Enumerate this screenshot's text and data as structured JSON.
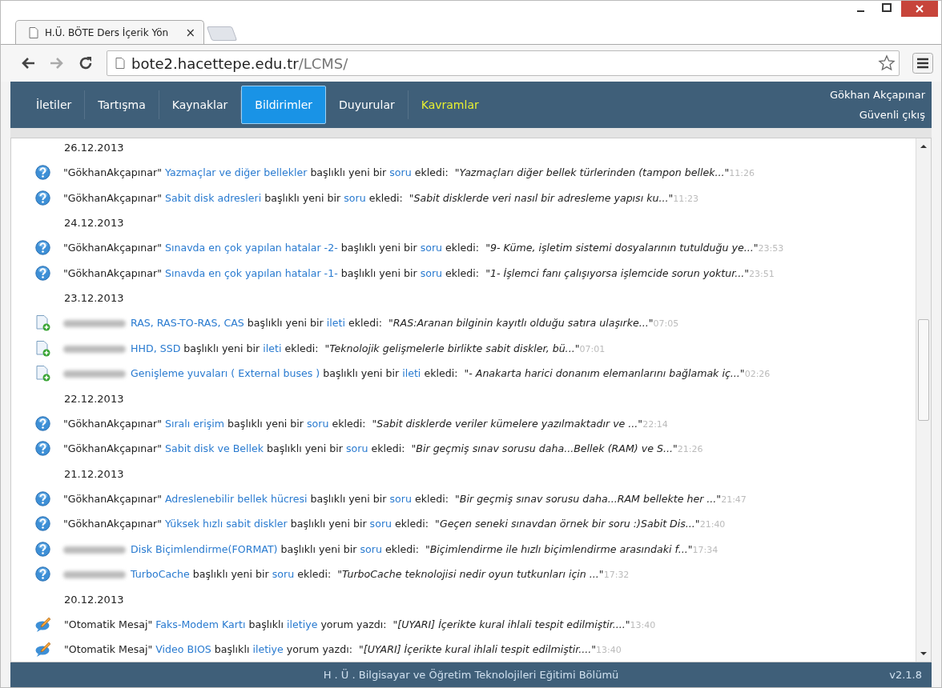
{
  "browser": {
    "tab_title": "H.Ü. BÖTE Ders İçerik Yön",
    "tab_close": "×",
    "url": {
      "host": "bote2.hacettepe.edu.tr",
      "path": "/LCMS/"
    }
  },
  "nav": {
    "items": [
      {
        "label": "İletiler",
        "selected": false,
        "highlight": false
      },
      {
        "label": "Tartışma",
        "selected": false,
        "highlight": false
      },
      {
        "label": "Kaynaklar",
        "selected": false,
        "highlight": false
      },
      {
        "label": "Bildirimler",
        "selected": true,
        "highlight": false
      },
      {
        "label": "Duyurular",
        "selected": false,
        "highlight": false
      },
      {
        "label": "Kavramlar",
        "selected": false,
        "highlight": true
      }
    ],
    "user": "Gökhan Akçapınar",
    "logout": "Güvenli çıkış"
  },
  "groups": [
    {
      "date": "26.12.2013",
      "items": [
        {
          "kind": "question",
          "author": "\"GökhanAkçapınar\"",
          "title": "Yazmaçlar ve diğer bellekler",
          "middle": "başlıklı yeni bir",
          "type_word": "soru",
          "verb": "ekledi:",
          "excerpt": "\"Yazmaçları diğer bellek türlerinden (tampon bellek...\"",
          "time": "11:26"
        },
        {
          "kind": "question",
          "author": "\"GökhanAkçapınar\"",
          "title": "Sabit disk adresleri",
          "middle": "başlıklı yeni bir",
          "type_word": "soru",
          "verb": "ekledi:",
          "excerpt": "\"Sabit disklerde veri nasıl bir adresleme yapısı ku...\"",
          "time": "11:23"
        }
      ]
    },
    {
      "date": "24.12.2013",
      "items": [
        {
          "kind": "question",
          "author": "\"GökhanAkçapınar\"",
          "title": "Sınavda en çok yapılan hatalar -2-",
          "middle": "başlıklı yeni bir",
          "type_word": "soru",
          "verb": "ekledi:",
          "excerpt": "\"9- Küme, işletim sistemi dosyalarının tutulduğu ye...\"",
          "time": "23:53"
        },
        {
          "kind": "question",
          "author": "\"GökhanAkçapınar\"",
          "title": "Sınavda en çok yapılan hatalar -1-",
          "middle": "başlıklı yeni bir",
          "type_word": "soru",
          "verb": "ekledi:",
          "excerpt": "\"1- İşlemci fanı çalışıyorsa işlemcide sorun yoktur...\"",
          "time": "23:51"
        }
      ]
    },
    {
      "date": "23.12.2013",
      "items": [
        {
          "kind": "document",
          "author_redacted": true,
          "title": "RAS, RAS-TO-RAS, CAS",
          "middle": "başlıklı yeni bir",
          "type_word": "ileti",
          "verb": "ekledi:",
          "excerpt": "\"RAS:Aranan bilginin kayıtlı olduğu satıra ulaşırke...\"",
          "time": "07:05"
        },
        {
          "kind": "document",
          "author_redacted": true,
          "title": "HHD, SSD",
          "middle": "başlıklı yeni bir",
          "type_word": "ileti",
          "verb": "ekledi:",
          "excerpt": "\"Teknolojik gelişmelerle birlikte sabit diskler, bü...\"",
          "time": "07:01"
        },
        {
          "kind": "document",
          "author_redacted": true,
          "title": "Genişleme yuvaları ( External buses )",
          "middle": "başlıklı yeni bir",
          "type_word": "ileti",
          "verb": "ekledi:",
          "excerpt": "\"- Anakarta harici donanım elemanlarını bağlamak iç...\"",
          "time": "02:26"
        }
      ]
    },
    {
      "date": "22.12.2013",
      "items": [
        {
          "kind": "question",
          "author": "\"GökhanAkçapınar\"",
          "title": "Sıralı erişim",
          "middle": "başlıklı yeni bir",
          "type_word": "soru",
          "verb": "ekledi:",
          "excerpt": "\"Sabit disklerde veriler kümelere yazılmaktadır ve ...\"",
          "time": "22:14"
        },
        {
          "kind": "question",
          "author": "\"GökhanAkçapınar\"",
          "title": "Sabit disk ve Bellek",
          "middle": "başlıklı yeni bir",
          "type_word": "soru",
          "verb": "ekledi:",
          "excerpt": "\"Bir geçmiş sınav sorusu daha...Bellek (RAM) ve S...\"",
          "time": "21:26"
        }
      ]
    },
    {
      "date": "21.12.2013",
      "items": [
        {
          "kind": "question",
          "author": "\"GökhanAkçapınar\"",
          "title": "Adreslenebilir bellek hücresi",
          "middle": "başlıklı yeni bir",
          "type_word": "soru",
          "verb": "ekledi:",
          "excerpt": "\"Bir geçmiş sınav sorusu daha...RAM bellekte her ...\"",
          "time": "21:47"
        },
        {
          "kind": "question",
          "author": "\"GökhanAkçapınar\"",
          "title": "Yüksek hızlı sabit diskler",
          "middle": "başlıklı yeni bir",
          "type_word": "soru",
          "verb": "ekledi:",
          "excerpt": "\"Geçen seneki sınavdan örnek bir soru :)Sabit Dis...\"",
          "time": "21:40"
        },
        {
          "kind": "question",
          "author_redacted": true,
          "title": "Disk Biçimlendirme(FORMAT)",
          "middle": "başlıklı yeni bir",
          "type_word": "soru",
          "verb": "ekledi:",
          "excerpt": "\"Biçimlendirme ile hızlı biçimlendirme arasındaki f...\"",
          "time": "17:34"
        },
        {
          "kind": "question",
          "author_redacted": true,
          "title": "TurboCache",
          "middle": "başlıklı yeni bir",
          "type_word": "soru",
          "verb": "ekledi:",
          "excerpt": "\"TurboCache teknolojisi nedir oyun tutkunları için ...\"",
          "time": "17:32"
        }
      ]
    },
    {
      "date": "20.12.2013",
      "items": [
        {
          "kind": "comment",
          "author": "\"Otomatik Mesaj\"",
          "title": "Faks-Modem Kartı",
          "middle": "başlıklı",
          "type_word": "iletiye",
          "verb": "yorum yazdı:",
          "excerpt": "\"[UYARI] İçerikte kural ihlali tespit edilmiştir....\"",
          "time": "13:40"
        },
        {
          "kind": "comment",
          "author": "\"Otomatik Mesaj\"",
          "title": "Video BIOS",
          "middle": "başlıklı",
          "type_word": "iletiye",
          "verb": "yorum yazdı:",
          "excerpt": "\"[UYARI] İçerikte kural ihlali tespit edilmiştir....\"",
          "time": "13:40"
        }
      ]
    }
  ],
  "footer": {
    "text": "H . Ü . Bilgisayar ve Öğretim Teknolojileri Eğitimi Bölümü",
    "version": "v2.1.8"
  }
}
